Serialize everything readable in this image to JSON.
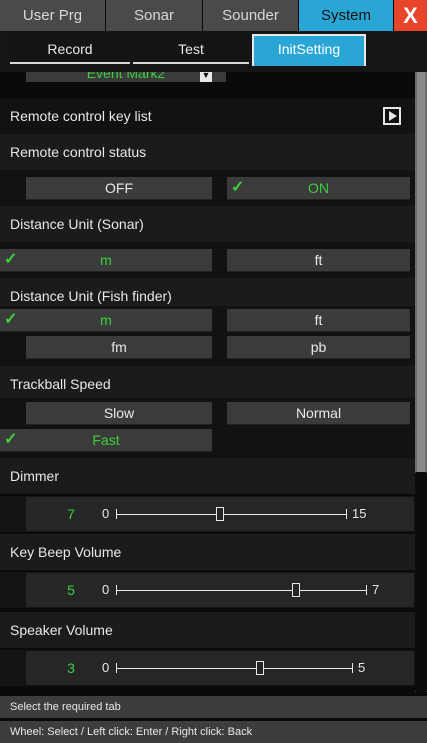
{
  "top_tabs": [
    "User Prg",
    "Sonar",
    "Sounder",
    "System"
  ],
  "close_label": "X",
  "sub_tabs": [
    "Record",
    "Test",
    "InitSetting"
  ],
  "event_mark": "Event Mark2",
  "remote_key_list": "Remote control key list",
  "remote_status": {
    "label": "Remote control status",
    "off": "OFF",
    "on": "ON"
  },
  "distance_sonar": {
    "label": "Distance Unit (Sonar)",
    "m": "m",
    "ft": "ft"
  },
  "distance_fish": {
    "label": "Distance Unit (Fish finder)",
    "m": "m",
    "ft": "ft",
    "fm": "fm",
    "pb": "pb"
  },
  "trackball": {
    "label": "Trackball Speed",
    "slow": "Slow",
    "normal": "Normal",
    "fast": "Fast"
  },
  "dimmer": {
    "label": "Dimmer",
    "value": "7",
    "min": "0",
    "max": "15"
  },
  "key_beep": {
    "label": "Key Beep Volume",
    "value": "5",
    "min": "0",
    "max": "7"
  },
  "speaker": {
    "label": "Speaker Volume",
    "value": "3",
    "min": "0",
    "max": "5"
  },
  "status_text": "Select the required tab",
  "hint_text": "Wheel: Select / Left click: Enter / Right click: Back",
  "check_mark": "✓",
  "colors": {
    "accent": "#2aa6d6",
    "close": "#e8442a",
    "selected": "#3bd13b"
  }
}
